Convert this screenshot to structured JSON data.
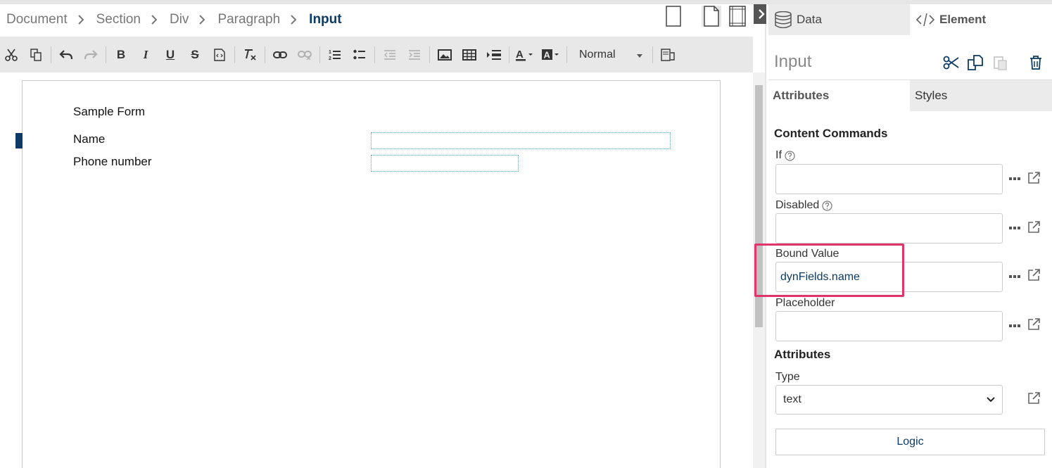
{
  "breadcrumb": [
    "Document",
    "Section",
    "Div",
    "Paragraph",
    "Input"
  ],
  "view_icons": [
    "page-portrait-icon",
    "page-document-icon",
    "page-margins-icon"
  ],
  "toolbar": {
    "style_select": "Normal",
    "icons": [
      "cut-icon",
      "copy-icon",
      "undo-icon",
      "redo-icon",
      "bold-icon",
      "italic-icon",
      "underline-icon",
      "strikethrough-icon",
      "source-icon",
      "clear-format-icon",
      "link-icon",
      "unlink-icon",
      "numbered-list-icon",
      "bullet-list-icon",
      "outdent-icon",
      "indent-icon",
      "image-icon",
      "table-icon",
      "insert-row-icon",
      "text-color-icon",
      "background-color-icon",
      "spellcheck-icon"
    ]
  },
  "document": {
    "title": "Sample Form",
    "fields": [
      {
        "label": "Name"
      },
      {
        "label": "Phone number"
      }
    ]
  },
  "panel": {
    "tabs": {
      "data": "Data",
      "element": "Element"
    },
    "element_name": "Input",
    "subtabs": {
      "attributes": "Attributes",
      "styles": "Styles"
    },
    "content_commands": "Content Commands",
    "fields": {
      "if_label": "If",
      "if_value": "",
      "disabled_label": "Disabled",
      "disabled_value": "",
      "bound_label": "Bound Value",
      "bound_value": "dynFields.name",
      "placeholder_label": "Placeholder",
      "placeholder_value": ""
    },
    "attributes_heading": "Attributes",
    "type_label": "Type",
    "type_value": "text",
    "logic_button": "Logic"
  },
  "colors": {
    "accent": "#0c3b66",
    "highlight": "#e0346a",
    "toolbar_bg": "#e8e8e8"
  }
}
